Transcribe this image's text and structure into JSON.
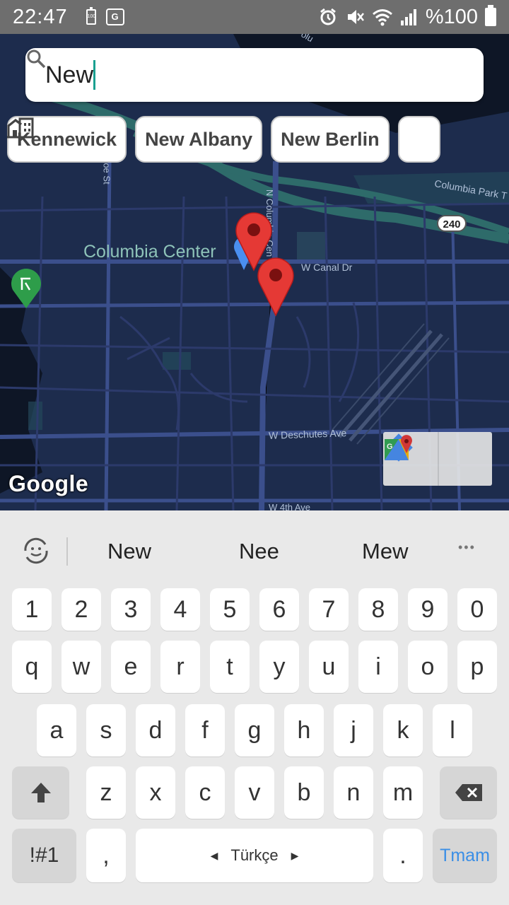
{
  "status_bar": {
    "time": "22:47",
    "battery_small_label": "100",
    "translate_icon": "translate-icon",
    "battery_percent": "%100",
    "icons": [
      "alarm-icon",
      "mute-icon",
      "wifi-icon",
      "signal-icon",
      "battery-icon"
    ]
  },
  "search": {
    "value": "New",
    "icon": "search-icon"
  },
  "chips": [
    {
      "label": "Kennewick",
      "icon": "building-icon"
    },
    {
      "label": "New Albany",
      "icon": "building-icon"
    },
    {
      "label": "New Berlin",
      "icon": "building-icon"
    }
  ],
  "map": {
    "place_label": "Columbia Center",
    "roads": {
      "columbia_park": "Columbia Park T",
      "highway": "240",
      "canal": "W Canal Dr",
      "deschutes": "W Deschutes Ave",
      "fourth": "W 4th Ave",
      "n_columbia": "N Columbia Cen",
      "st": "oe St",
      "top": "olu"
    },
    "logo": "Google",
    "buttons": [
      "directions-icon",
      "google-maps-icon"
    ]
  },
  "keyboard": {
    "suggestions": [
      "New",
      "Nee",
      "Mew"
    ],
    "more_label": "•••",
    "number_row": [
      "1",
      "2",
      "3",
      "4",
      "5",
      "6",
      "7",
      "8",
      "9",
      "0"
    ],
    "row1": [
      "q",
      "w",
      "e",
      "r",
      "t",
      "y",
      "u",
      "i",
      "o",
      "p"
    ],
    "row2": [
      "a",
      "s",
      "d",
      "f",
      "g",
      "h",
      "j",
      "k",
      "l"
    ],
    "row3": [
      "z",
      "x",
      "c",
      "v",
      "b",
      "n",
      "m"
    ],
    "symbols_label": "!#1",
    "comma_label": ",",
    "space_label": "Türkçe",
    "period_label": ".",
    "done_label": "Tmam",
    "colors": {
      "done": "#3a8ee6",
      "accent": "#1aa090"
    }
  }
}
